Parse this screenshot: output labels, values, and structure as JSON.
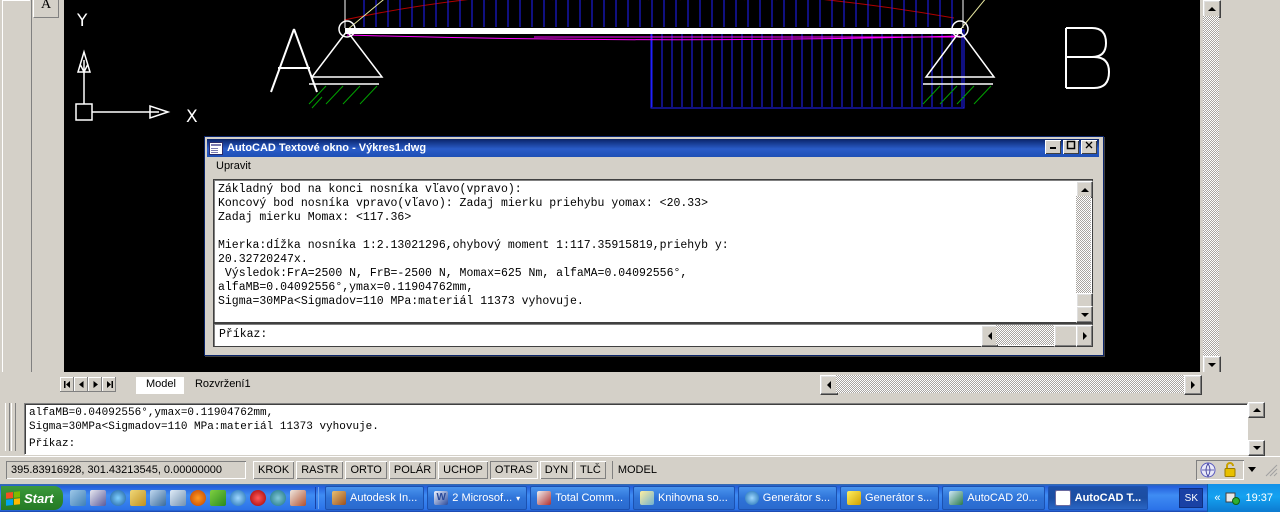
{
  "text_window": {
    "title": "AutoCAD Textové okno - Výkres1.dwg",
    "icon": "text-window-icon",
    "menu": {
      "upravit": "Upravit"
    },
    "buttons": {
      "minimize": "_",
      "maximize": "□",
      "close": "✕"
    },
    "console_lines": [
      "Základný bod na konci nosníka vľavo(vpravo):",
      "Koncový bod nosníka vpravo(vľavo): Zadaj mierku priehybu yomax: <20.33>",
      "Zadaj mierku Momax: <117.36>",
      "",
      "Mierka:dĺžka nosníka 1:2.13021296,ohybový moment 1:117.35915819,priehyb y:",
      "20.32720247x.",
      " Výsledok:FrA=2500 N, FrB=-2500 N, Momax=625 Nm, alfaMA=0.04092556°,",
      "alfaMB=0.04092556°,ymax=0.11904762mm,",
      "Sigma=30MPa<Sigmadov=110 MPa:materiál 11373 vyhovuje."
    ],
    "prompt": "Příkaz:"
  },
  "command_line": {
    "lines": [
      "alfaMB=0.04092556°,ymax=0.11904762mm,",
      "Sigma=30MPa<Sigmadov=110 MPa:materiál 11373 vyhovuje."
    ],
    "prompt": "Příkaz:"
  },
  "layout_tabs": {
    "nav": [
      "first-tab-icon",
      "prev-tab-icon",
      "next-tab-icon",
      "last-tab-icon"
    ],
    "tabs": [
      {
        "label": "Model",
        "active": true
      },
      {
        "label": "Rozvržení1",
        "active": false
      }
    ]
  },
  "status_bar": {
    "coordinates": "395.83916928, 301.43213545, 0.00000000",
    "toggles": [
      {
        "label": "KROK",
        "pressed": false
      },
      {
        "label": "RASTR",
        "pressed": false
      },
      {
        "label": "ORTO",
        "pressed": false
      },
      {
        "label": "POLÁR",
        "pressed": false
      },
      {
        "label": "UCHOP",
        "pressed": false
      },
      {
        "label": "OTRAS",
        "pressed": true
      },
      {
        "label": "DYN",
        "pressed": false
      },
      {
        "label": "TLČ",
        "pressed": false
      },
      {
        "label": "MODEL",
        "pressed": false
      }
    ],
    "tray_icons": [
      "communication-center-icon",
      "lock-icon"
    ]
  },
  "toolbar": {
    "text_tool_label": "A"
  },
  "drawing": {
    "label_a": "A",
    "label_b": "B",
    "ucs_x": "X",
    "ucs_y": "Y",
    "colors": {
      "background": "#000000",
      "beam": "#ffffff",
      "moment_diagram": "#0000ff",
      "load_hatch": "#800000",
      "deflection": "#ff00ff",
      "support_hatch": "#008000",
      "dimension": "#ffffaa"
    }
  },
  "taskbar": {
    "start_label": "Start",
    "quick_launch": [
      "show-desktop-icon",
      "save-icon",
      "media-player-icon",
      "scissors-icon",
      "internet-icon",
      "document-icon",
      "firefox-icon",
      "update-icon",
      "ie-icon",
      "opera-icon",
      "browser-icon",
      "mail-icon"
    ],
    "tasks": [
      {
        "label": "Autodesk In...",
        "icon": "autodesk-icon",
        "active": false
      },
      {
        "label": "2 Microsof...",
        "icon": "word-icon",
        "active": false,
        "group": true
      },
      {
        "label": "Total Comm...",
        "icon": "total-commander-icon",
        "active": false
      },
      {
        "label": "Knihovna so...",
        "icon": "library-icon",
        "active": false
      },
      {
        "label": "Generátor s...",
        "icon": "ie-icon",
        "active": false
      },
      {
        "label": "Generátor s...",
        "icon": "text-cursor-icon",
        "active": false
      },
      {
        "label": "AutoCAD 20...",
        "icon": "autocad-icon",
        "active": false
      },
      {
        "label": "AutoCAD T...",
        "icon": "text-window-icon",
        "active": true
      }
    ],
    "language": "SK",
    "tray": {
      "expand": "«",
      "icons": [
        "network-icon"
      ],
      "clock": "19:37"
    }
  }
}
